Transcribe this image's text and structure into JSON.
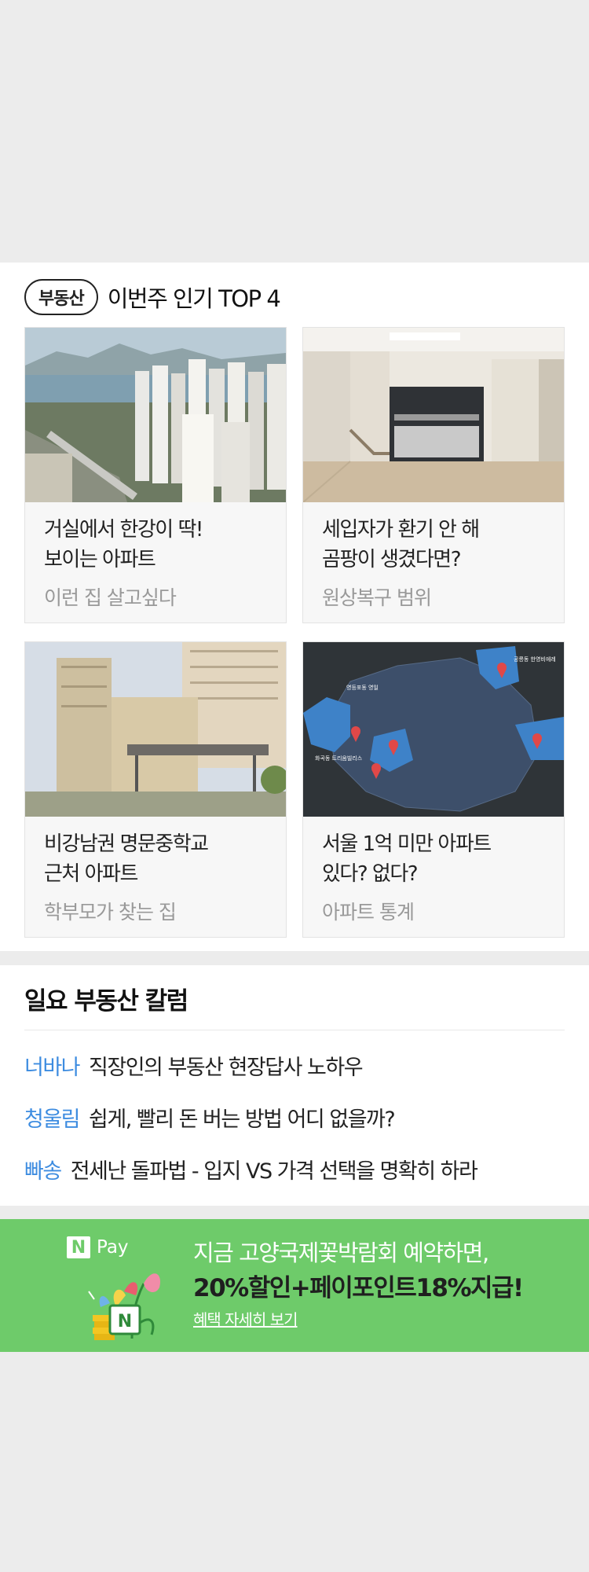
{
  "realestate": {
    "badge": "부동산",
    "title": "이번주 인기 TOP 4",
    "cards": [
      {
        "title": "거실에서 한강이 딱!\n보이는 아파트",
        "subtitle": "이런 집 살고싶다"
      },
      {
        "title": "세입자가 환기 안 해\n곰팡이 생겼다면?",
        "subtitle": "원상복구 범위"
      },
      {
        "title": "비강남권 명문중학교\n근처 아파트",
        "subtitle": "학부모가 찾는 집"
      },
      {
        "title": "서울 1억 미만 아파트\n있다? 없다?",
        "subtitle": "아파트 통계"
      }
    ]
  },
  "column": {
    "title": "일요 부동산 칼럼",
    "items": [
      {
        "author": "너바나",
        "text": "직장인의 부동산 현장답사 노하우"
      },
      {
        "author": "청울림",
        "text": "쉽게, 빨리 돈 버는 방법 어디 없을까?"
      },
      {
        "author": "빠송",
        "text": "전세난 돌파법 - 입지 VS 가격 선택을 명확히 하라"
      }
    ]
  },
  "banner": {
    "brand_n": "N",
    "brand_pay": "Pay",
    "line1": "지금 고양국제꽃박람회 예약하면,",
    "line2": "20%할인+페이포인트18%지급!",
    "link": "혜택 자세히 보기",
    "bg_color": "#6ecb6a"
  },
  "map_labels": {
    "label_a": "공릉동 한영비에레",
    "label_b": "영등포동 영일",
    "label_c": "화곡동 트리움빌리스"
  }
}
